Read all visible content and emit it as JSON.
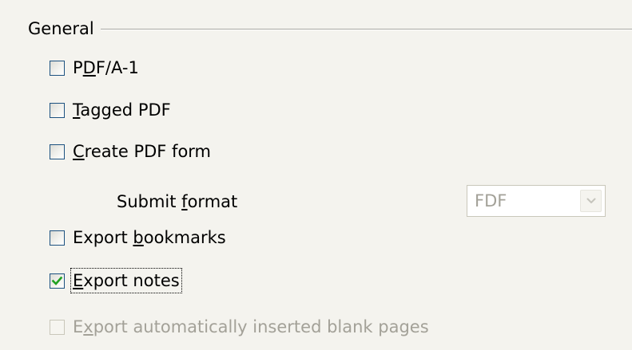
{
  "group": {
    "title": "General"
  },
  "options": [
    {
      "label_parts": [
        "P",
        "D",
        "F/A-1"
      ],
      "checked": false,
      "enabled": true
    },
    {
      "label_parts": [
        "",
        "T",
        "agged PDF"
      ],
      "checked": false,
      "enabled": true
    },
    {
      "label_parts": [
        "",
        "C",
        "reate PDF form"
      ],
      "checked": false,
      "enabled": true
    },
    {
      "label_parts": [
        "Export ",
        "b",
        "ookmarks"
      ],
      "checked": false,
      "enabled": true
    },
    {
      "label_parts": [
        "",
        "E",
        "xport notes"
      ],
      "checked": true,
      "enabled": true,
      "focused": true
    },
    {
      "label_parts": [
        "E",
        "x",
        "port automatically inserted blank pages"
      ],
      "checked": false,
      "enabled": false
    }
  ],
  "submit_format": {
    "label_parts": [
      "Submit ",
      "f",
      "ormat"
    ],
    "value": "FDF",
    "enabled": false
  },
  "icons": {
    "check": "checkmark-icon",
    "dropdown": "chevron-down-icon"
  },
  "colors": {
    "background": "#f4f3ee",
    "checkbox_border": "#1c5180",
    "checkmark": "#21a121",
    "disabled_text": "#a3a198"
  }
}
